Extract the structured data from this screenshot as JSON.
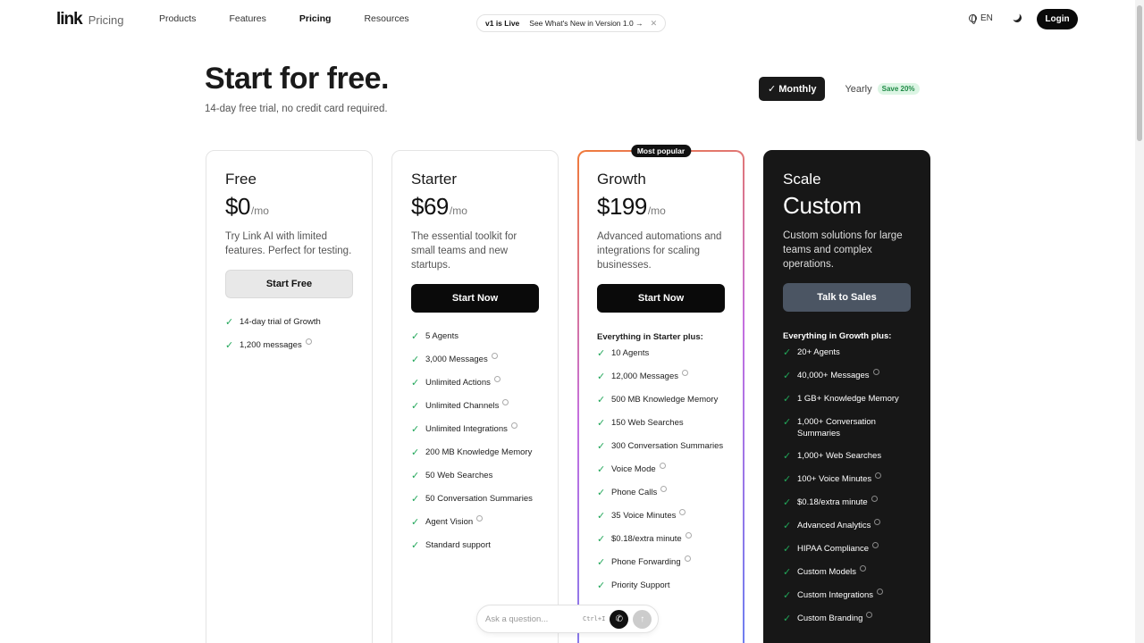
{
  "nav": {
    "logo": "link",
    "logo_sub": "Pricing",
    "links": [
      "Products",
      "Features",
      "Pricing",
      "Resources"
    ],
    "announcement": {
      "tag": "v1 is Live",
      "message": "See What's New in Version 1.0 →",
      "close": "✕"
    },
    "language": "EN",
    "login": "Login"
  },
  "hero": {
    "title": "Start for free.",
    "subtitle": "14-day free trial, no credit card required."
  },
  "billing": {
    "monthly": "✓ Monthly",
    "yearly": "Yearly",
    "save": "Save 20%"
  },
  "plans": {
    "free": {
      "name": "Free",
      "price": "$0",
      "unit": "/mo",
      "desc": "Try Link AI with limited features. Perfect for testing.",
      "cta": "Start Free",
      "features": [
        "14-day trial of Growth",
        "1,200 messages"
      ]
    },
    "starter": {
      "name": "Starter",
      "price": "$69",
      "unit": "/mo",
      "desc": "The essential toolkit for small teams and new startups.",
      "cta": "Start Now",
      "features": [
        "5 Agents",
        "3,000 Messages",
        "Unlimited Actions",
        "Unlimited Channels",
        "Unlimited Integrations",
        "200 MB Knowledge Memory",
        "50 Web Searches",
        "50 Conversation Summaries",
        "Agent Vision",
        "Standard support"
      ]
    },
    "growth": {
      "badge": "Most popular",
      "name": "Growth",
      "price": "$199",
      "unit": "/mo",
      "desc": "Advanced automations and integrations for scaling businesses.",
      "cta": "Start Now",
      "heading": "Everything in Starter plus:",
      "features": [
        "10 Agents",
        "12,000 Messages",
        "500 MB Knowledge Memory",
        "150 Web Searches",
        "300 Conversation Summaries",
        "Voice Mode",
        "Phone Calls",
        "35 Voice Minutes",
        "$0.18/extra minute",
        "Phone Forwarding",
        "Priority Support"
      ]
    },
    "scale": {
      "name": "Scale",
      "price": "Custom",
      "desc": "Custom solutions for large teams and complex operations.",
      "cta": "Talk to Sales",
      "heading": "Everything in Growth plus:",
      "features": [
        "20+ Agents",
        "40,000+ Messages",
        "1 GB+ Knowledge Memory",
        "1,000+ Conversation Summaries",
        "1,000+ Web Searches",
        "100+ Voice Minutes",
        "$0.18/extra minute",
        "Advanced Analytics",
        "HIPAA Compliance",
        "Custom Models",
        "Custom Integrations",
        "Custom Branding"
      ]
    }
  },
  "ask": {
    "placeholder": "Ask a question...",
    "shortcut": "Ctrl+I"
  }
}
